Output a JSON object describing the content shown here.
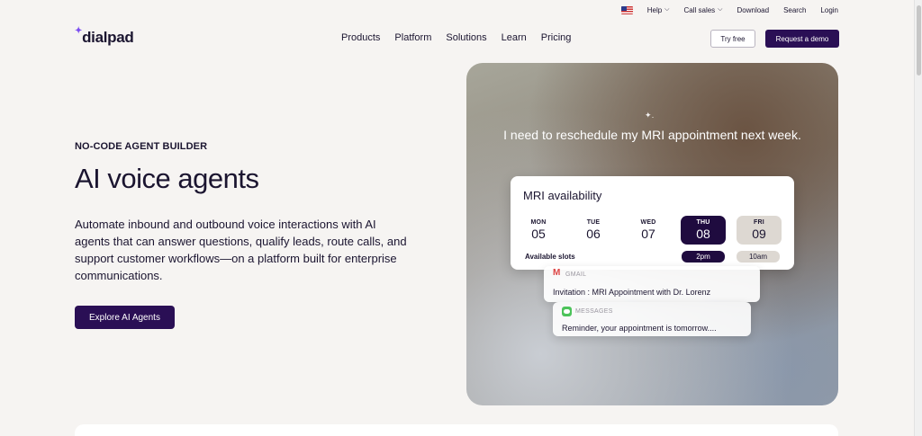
{
  "utility": {
    "help": "Help",
    "call_sales": "Call sales",
    "download": "Download",
    "search": "Search",
    "login": "Login"
  },
  "nav": {
    "logo": "dialpad",
    "items": [
      {
        "label": "Products"
      },
      {
        "label": "Platform"
      },
      {
        "label": "Solutions"
      },
      {
        "label": "Learn"
      },
      {
        "label": "Pricing"
      }
    ],
    "try_free": "Try free",
    "request_demo": "Request a demo"
  },
  "hero": {
    "eyebrow": "NO-CODE AGENT BUILDER",
    "title": "AI voice agents",
    "description": "Automate inbound and outbound voice interactions with AI agents that can answer questions, qualify leads, route calls, and support customer workflows—on a platform built for enterprise communications.",
    "cta": "Explore AI Agents"
  },
  "visual": {
    "quote": "I need to reschedule my MRI appointment next week.",
    "card": {
      "title": "MRI availability",
      "days": [
        {
          "name": "MON",
          "date": "05",
          "state": "default"
        },
        {
          "name": "TUE",
          "date": "06",
          "state": "default"
        },
        {
          "name": "WED",
          "date": "07",
          "state": "default"
        },
        {
          "name": "THU",
          "date": "08",
          "state": "selected"
        },
        {
          "name": "FRI",
          "date": "09",
          "state": "alt"
        }
      ],
      "slots_label": "Available slots",
      "slots": [
        "2pm",
        "10am"
      ]
    },
    "gmail": {
      "app": "GMAIL",
      "text": "Invitation : MRI Appointment with Dr. Lorenz"
    },
    "messages": {
      "app": "MESSAGES",
      "text": "Reminder, your appointment is tomorrow...."
    }
  },
  "colors": {
    "brand_dark": "#2a0f55",
    "accent": "#7b4df0",
    "page_bg": "#f6f4f2"
  }
}
